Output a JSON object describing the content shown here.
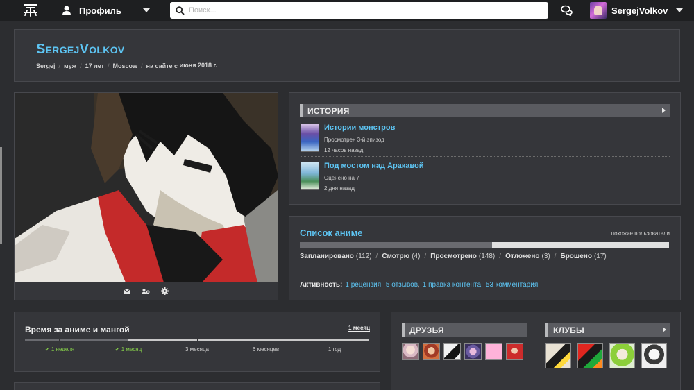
{
  "topbar": {
    "logo_icon": "shikimori-logo",
    "profile_label": "Профиль",
    "search_placeholder": "Поиск...",
    "chat_icon": "chat-bubbles-icon",
    "user_name": "SergejVolkov"
  },
  "profile": {
    "username": "SergejVolkov",
    "meta": [
      "Sergej",
      "муж",
      "17 лет",
      "Moscow"
    ],
    "since_prefix": "на сайте с",
    "since_date": "июня 2018 г."
  },
  "avatar_tools": [
    {
      "icon": "envelope-icon"
    },
    {
      "icon": "users-cog-icon"
    },
    {
      "icon": "settings-icon"
    }
  ],
  "history": {
    "title": "ИСТОРИЯ",
    "items": [
      {
        "title": "Истории монстров",
        "sub": "Просмотрен 3-й эпизод",
        "time": "12 часов назад"
      },
      {
        "title": "Под мостом над Аракавой",
        "sub": "Оценено на 7",
        "time": "2 дня назад"
      }
    ]
  },
  "anime_list": {
    "title": "Список аниме",
    "similar_link": "похожие пользователи",
    "progress_fraction": 0.52,
    "stats": [
      {
        "label": "Запланировано",
        "count": "(112)"
      },
      {
        "label": "Смотрю",
        "count": "(4)"
      },
      {
        "label": "Просмотрено",
        "count": "(148)"
      },
      {
        "label": "Отложено",
        "count": "(3)"
      },
      {
        "label": "Брошено",
        "count": "(17)"
      }
    ],
    "activity_label": "Активность:",
    "activity": [
      "1 рецензия",
      "5 отзывов",
      "1 правка контента",
      "53 комментария"
    ]
  },
  "time_card": {
    "title": "Время за аниме и мангой",
    "selected": "1 месяц",
    "progress_fraction": 0.3,
    "labels": [
      {
        "text": "1 неделя",
        "checked": true
      },
      {
        "text": "1 месяц",
        "checked": true
      },
      {
        "text": "3 месяца",
        "checked": false
      },
      {
        "text": "6 месяцев",
        "checked": false
      },
      {
        "text": "1 год",
        "checked": false
      }
    ]
  },
  "friends": {
    "title": "ДРУЗЬЯ"
  },
  "clubs": {
    "title": "КЛУБЫ"
  },
  "colors": {
    "accent": "#5dc4f2",
    "background": "#2c2d30",
    "card": "#35363a",
    "check": "#86d04a"
  }
}
